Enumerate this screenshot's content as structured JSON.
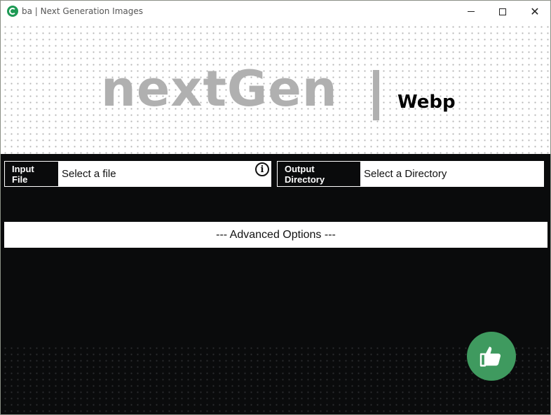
{
  "window": {
    "title": "ba | Next Generation Images",
    "app_icon": "app-logo-icon",
    "controls": [
      "minimize-icon",
      "maximize-icon",
      "close-icon"
    ]
  },
  "banner": {
    "brand": "nextGen",
    "separator": "|",
    "format": "Webp"
  },
  "input": {
    "label": "Input File",
    "value": "Select a file",
    "info_icon": "info-icon"
  },
  "output": {
    "label": "Output Directory",
    "value": "Select a Directory"
  },
  "advanced": {
    "label": "--- Advanced Options ---"
  },
  "action": {
    "icon": "thumbs-up-icon",
    "color": "#3f9a5f"
  },
  "colors": {
    "background": "#0a0b0c",
    "brand_grey": "#b0b0b0",
    "panel": "#ffffff"
  }
}
